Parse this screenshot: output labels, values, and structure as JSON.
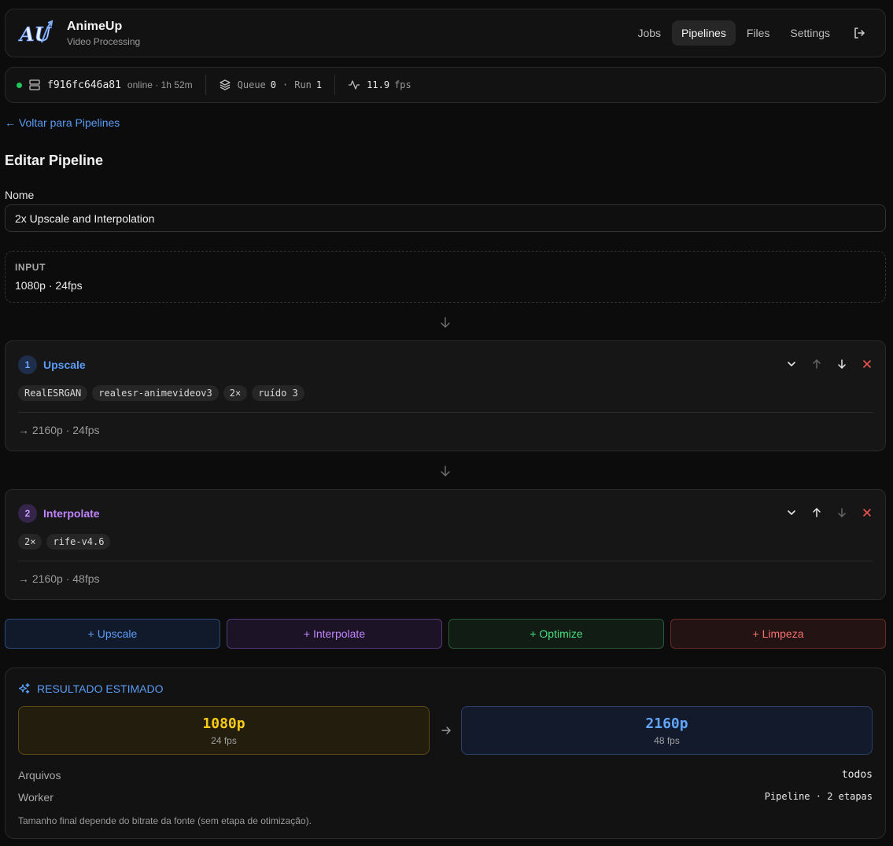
{
  "app": {
    "title": "AnimeUp",
    "subtitle": "Video Processing",
    "logo_text": "AU"
  },
  "nav": {
    "items": [
      {
        "label": "Jobs",
        "active": false
      },
      {
        "label": "Pipelines",
        "active": true
      },
      {
        "label": "Files",
        "active": false
      },
      {
        "label": "Settings",
        "active": false
      }
    ],
    "logout_icon": "logout-icon"
  },
  "status": {
    "worker_id": "f916fc646a81",
    "state": "online · 1h 52m",
    "queue_label": "Queue",
    "queue_value": "0",
    "run_label": "Run",
    "run_value": "1",
    "separator": "·",
    "fps_value": "11.9",
    "fps_unit": "fps",
    "online_color": "#22c55e"
  },
  "back_link": "← Voltar para Pipelines",
  "page_title": "Editar Pipeline",
  "form": {
    "name_label": "Nome",
    "name_value": "2x Upscale and Interpolation"
  },
  "input": {
    "label": "INPUT",
    "value": "1080p · 24fps"
  },
  "stages": [
    {
      "number": "1",
      "name": "Upscale",
      "color": "#5b9cf6",
      "chips": [
        "RealESRGAN",
        "realesr-animevideov3",
        "2×",
        "ruído 3"
      ],
      "output": "→ 2160p · 24fps"
    },
    {
      "number": "2",
      "name": "Interpolate",
      "color": "#c084fc",
      "chips": [
        "2×",
        "rife-v4.6"
      ],
      "output": "→ 2160p · 48fps"
    }
  ],
  "add_buttons": [
    {
      "label": "+ Upscale",
      "color": "#5b9cf6"
    },
    {
      "label": "+ Interpolate",
      "color": "#c084fc"
    },
    {
      "label": "+ Optimize",
      "color": "#4ade80"
    },
    {
      "label": "+ Limpeza",
      "color": "#f87171"
    }
  ],
  "result": {
    "title": "RESULTADO ESTIMADO",
    "from": {
      "resolution": "1080p",
      "fps": "24 fps",
      "color": "#facc15"
    },
    "to": {
      "resolution": "2160p",
      "fps": "48 fps",
      "color": "#60a5fa"
    },
    "rows": [
      {
        "key": "Arquivos",
        "value": "todos"
      },
      {
        "key": "Worker",
        "value": "Pipeline · 2 etapas"
      }
    ],
    "note": "Tamanho final depende do bitrate da fonte (sem etapa de otimização)."
  }
}
